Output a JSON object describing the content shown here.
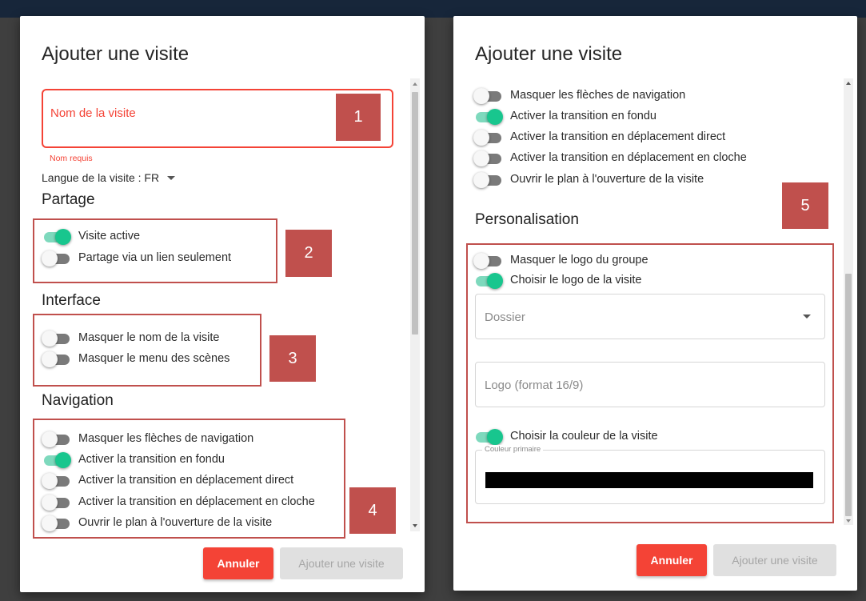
{
  "left": {
    "title": "Ajouter une visite",
    "name_field": {
      "placeholder": "Nom de la visite",
      "error": "Nom requis"
    },
    "language": {
      "label": "Langue de la visite : FR"
    },
    "sections": {
      "sharing": "Partage",
      "interface": "Interface",
      "navigation": "Navigation"
    },
    "sharing_toggles": [
      {
        "label": "Visite active",
        "on": true
      },
      {
        "label": "Partage via un lien seulement",
        "on": false
      }
    ],
    "interface_toggles": [
      {
        "label": "Masquer le nom de la visite",
        "on": false
      },
      {
        "label": "Masquer le menu des scènes",
        "on": false
      }
    ],
    "navigation_toggles": [
      {
        "label": "Masquer les flèches de navigation",
        "on": false
      },
      {
        "label": "Activer la transition en fondu",
        "on": true
      },
      {
        "label": "Activer la transition en déplacement direct",
        "on": false
      },
      {
        "label": "Activer la transition en déplacement en cloche",
        "on": false
      },
      {
        "label": "Ouvrir le plan à l'ouverture de la visite",
        "on": false
      }
    ],
    "buttons": {
      "cancel": "Annuler",
      "add": "Ajouter une visite"
    },
    "badges": [
      "1",
      "2",
      "3",
      "4"
    ]
  },
  "right": {
    "title": "Ajouter une visite",
    "navigation_toggles": [
      {
        "label": "Masquer les flèches de navigation",
        "on": false
      },
      {
        "label": "Activer la transition en fondu",
        "on": true
      },
      {
        "label": "Activer la transition en déplacement direct",
        "on": false
      },
      {
        "label": "Activer la transition en déplacement en cloche",
        "on": false
      },
      {
        "label": "Ouvrir le plan à l'ouverture de la visite",
        "on": false
      }
    ],
    "section": "Personalisation",
    "badge": "5",
    "logo_toggles": [
      {
        "label": "Masquer le logo du groupe",
        "on": false
      },
      {
        "label": "Choisir le logo de la visite",
        "on": true
      }
    ],
    "folder_select": {
      "placeholder": "Dossier"
    },
    "logo_field": {
      "placeholder": "Logo (format 16/9)"
    },
    "color_toggle": {
      "label": "Choisir la couleur de la visite",
      "on": true
    },
    "color_field": {
      "label": "Couleur primaire",
      "value": "#000000"
    },
    "buttons": {
      "cancel": "Annuler",
      "add": "Ajouter une visite"
    }
  },
  "colors": {
    "toggle_on": "#18c68e",
    "cancel": "#f44336",
    "annotation": "#c0504d",
    "error": "#f44336"
  },
  "icons": [
    "chevron-down-icon",
    "scroll-up-arrow-icon",
    "scroll-down-arrow-icon"
  ]
}
